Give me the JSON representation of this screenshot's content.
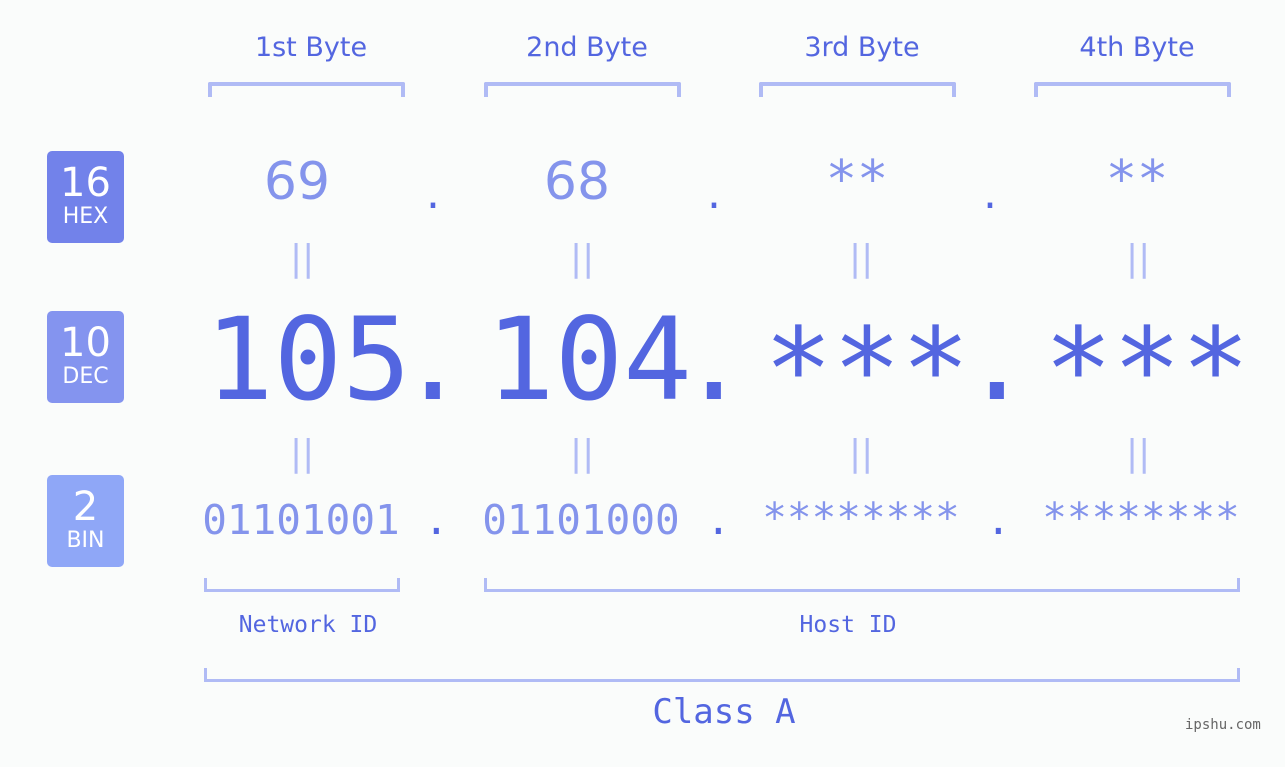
{
  "colors": {
    "hex_badge": "#7282ea",
    "dec_badge": "#8494ef",
    "bin_badge": "#8fa7f7",
    "accent": "#5366e0",
    "light_text": "#8494ec",
    "bracket": "#b0bbf5",
    "watermark": "#666666"
  },
  "badges": [
    {
      "number": "16",
      "label": "HEX"
    },
    {
      "number": "10",
      "label": "DEC"
    },
    {
      "number": "2",
      "label": "BIN"
    }
  ],
  "byte_headers": [
    "1st Byte",
    "2nd Byte",
    "3rd Byte",
    "4th Byte"
  ],
  "hex": [
    "69",
    "68",
    "**",
    "**"
  ],
  "dec": [
    "105",
    "104",
    "***",
    "***"
  ],
  "bin": [
    "01101001",
    "01101000",
    "********",
    "********"
  ],
  "separator": ".",
  "equals": "||",
  "network_id_label": "Network ID",
  "host_id_label": "Host ID",
  "class_label": "Class A",
  "watermark": "ipshu.com"
}
